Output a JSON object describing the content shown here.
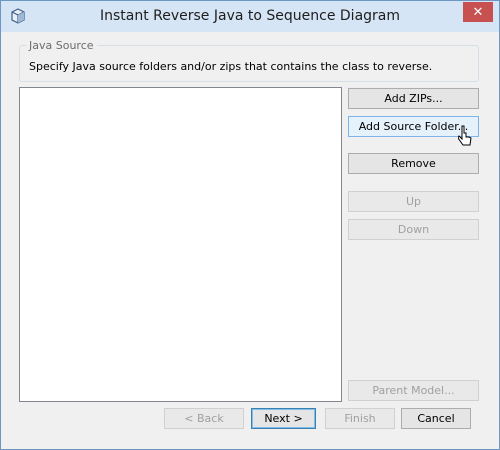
{
  "window": {
    "title": "Instant Reverse Java to Sequence Diagram",
    "close_symbol": "✕"
  },
  "group": {
    "legend": "Java Source",
    "description": "Specify Java source folders and/or zips that contains the class to reverse."
  },
  "side_buttons": {
    "add_zips": "Add ZIPs...",
    "add_source_folder": "Add Source Folder...",
    "remove": "Remove",
    "up": "Up",
    "down": "Down",
    "parent_model": "Parent Model..."
  },
  "footer_buttons": {
    "back": "< Back",
    "next": "Next >",
    "finish": "Finish",
    "cancel": "Cancel"
  },
  "icons": {
    "app": "cube-icon",
    "cursor": "pointer-cursor-icon"
  },
  "colors": {
    "titlebar": "#d6e5f5",
    "close_button": "#c75050",
    "dialog_background": "#f0f0f0"
  }
}
